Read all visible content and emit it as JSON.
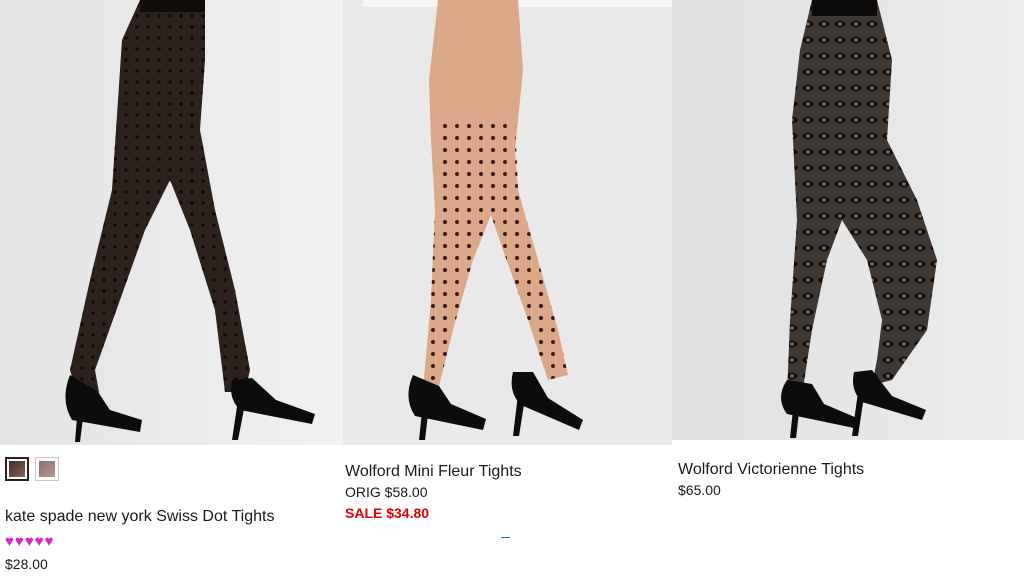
{
  "products": [
    {
      "name": "kate spade new york Swiss Dot Tights",
      "price": "$28.00",
      "rating_stars": 5,
      "rating_icon": "heart-icon",
      "heart_color": "#e020c8",
      "swatches": [
        {
          "color": "#6a4a3e",
          "selected": true
        },
        {
          "color": "#9a7d78",
          "selected": false
        }
      ]
    },
    {
      "name": "Wolford Mini Fleur Tights",
      "orig_price": "ORIG $58.00",
      "sale_price": "SALE $34.80",
      "sale_color": "#e00000"
    },
    {
      "name": "Wolford Victorienne Tights",
      "price": "$65.00"
    }
  ]
}
